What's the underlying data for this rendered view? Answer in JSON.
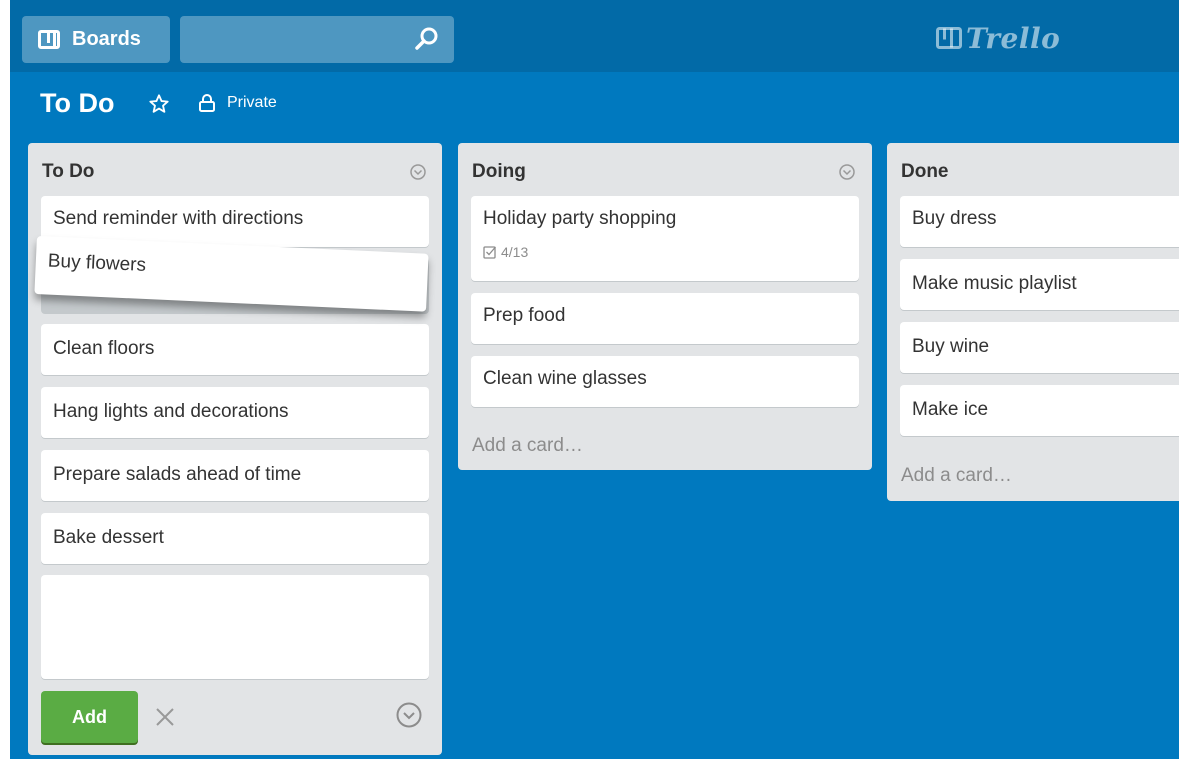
{
  "header": {
    "boards_label": "Boards",
    "search": {
      "value": "",
      "placeholder": ""
    },
    "logo_text": "Trello",
    "icons": [
      "boards-icon",
      "search-icon",
      "trello-logo-icon"
    ]
  },
  "board": {
    "title": "To Do",
    "starred": false,
    "privacy_label": "Private",
    "icons": [
      "star-icon",
      "lock-icon"
    ]
  },
  "lists": [
    {
      "title": "To Do",
      "cards": [
        {
          "title": "Send reminder with directions"
        },
        {
          "title": "Clean floors"
        },
        {
          "title": "Hang lights and decorations"
        },
        {
          "title": "Prepare salads ahead of time"
        },
        {
          "title": "Bake dessert"
        }
      ],
      "dragged_card": "Buy flowers",
      "composer": {
        "value": "",
        "add_button_label": "Add"
      }
    },
    {
      "title": "Doing",
      "cards": [
        {
          "title": "Holiday party shopping",
          "checklist": "4/13"
        },
        {
          "title": "Prep food"
        },
        {
          "title": "Clean wine glasses"
        }
      ],
      "add_card_label": "Add a card…"
    },
    {
      "title": "Done",
      "cards": [
        {
          "title": "Buy dress"
        },
        {
          "title": "Make music playlist"
        },
        {
          "title": "Buy wine"
        },
        {
          "title": "Make ice"
        }
      ],
      "add_card_label": "Add a card…"
    }
  ],
  "colors": {
    "board_background": "#0079bf",
    "header_background": "#026aa7",
    "list_background": "#e2e4e6",
    "add_button": "#5aac44"
  }
}
